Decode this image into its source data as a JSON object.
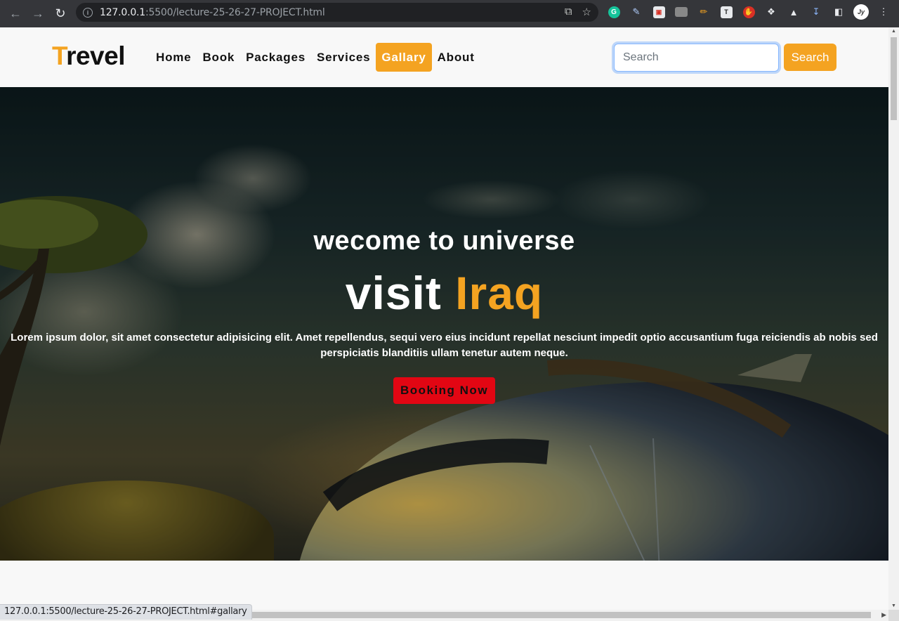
{
  "browser": {
    "url_host": "127.0.0.1",
    "url_rest": ":5500/lecture-25-26-27-PROJECT.html",
    "status_url": "127.0.0.1:5500/lecture-25-26-27-PROJECT.html#gallary"
  },
  "navbar": {
    "logo_first": "T",
    "logo_rest": "revel",
    "menu": [
      "Home",
      "Book",
      "Packages",
      "Services",
      "Gallary",
      "About"
    ],
    "active_menu": "Gallary",
    "search_placeholder": "Search",
    "search_button": "Search"
  },
  "hero": {
    "welcome": "wecome to universe",
    "visit_prefix": "visit ",
    "visit_highlight": "Iraq",
    "description": "Lorem ipsum dolor, sit amet consectetur adipisicing elit. Amet repellendus, sequi vero eius incidunt repellat nesciunt impedit optio accusantium fuga reiciendis ab nobis sed perspiciatis blanditiis ullam tenetur autem neque.",
    "button": "Booking Now"
  },
  "colors": {
    "accent": "#f4a321",
    "button_red": "#e20613",
    "chrome_bg": "#35363a"
  },
  "icons": [
    "back-arrow-icon",
    "forward-arrow-icon",
    "reload-icon",
    "info-icon",
    "share-icon",
    "star-icon",
    "grammarly-icon",
    "eyedropper-icon",
    "extension-icon",
    "puzzle-icon",
    "flask-icon",
    "download-icon",
    "sidebar-icon",
    "profile-avatar-icon",
    "more-menu-icon"
  ]
}
